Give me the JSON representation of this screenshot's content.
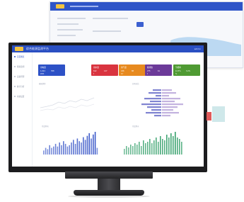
{
  "header": {
    "title": "综合能源监测平台",
    "user": "admin"
  },
  "sidebar": {
    "items": [
      {
        "label": "首页概览",
        "active": true
      },
      {
        "label": "能耗监测",
        "active": false
      },
      {
        "label": "设备管理",
        "active": false
      },
      {
        "label": "统计分析",
        "active": false
      },
      {
        "label": "系统设置",
        "active": false
      }
    ]
  },
  "stat_cards": [
    {
      "title": "用电量",
      "color": "#2d51c6",
      "v1": "1,024",
      "v2": "358",
      "v3": "kWh"
    },
    {
      "title": "用水量",
      "color": "#d9343f",
      "v1": "612",
      "v2": "127",
      "v3": "t"
    },
    {
      "title": "用气量",
      "color": "#e78a1f",
      "v1": "436",
      "v2": "88",
      "v3": "m³"
    },
    {
      "title": "碳排放",
      "color": "#6c3a99",
      "v1": "275",
      "v2": "61",
      "v3": "t"
    },
    {
      "title": "节能率",
      "color": "#4f9a33",
      "v1": "12.5%",
      "v2": "3.2%",
      "v3": "%"
    }
  ],
  "chart_labels": {
    "left_top": "能耗趋势",
    "right_top": "分项对比",
    "left_bottom": "月度用电",
    "right_bottom": "月度用水"
  },
  "colors": {
    "header": "#2a4fc2",
    "bar_blue": "#3c59c9",
    "bar_green": "#35a06b",
    "accent_yellow": "#f3c33f"
  },
  "bottom_bars_left": [
    3,
    5,
    4,
    7,
    5,
    6,
    8,
    6,
    9,
    7,
    10,
    8,
    6,
    7,
    9,
    11,
    8,
    12,
    10,
    9,
    13,
    11,
    14,
    16,
    12,
    15,
    17,
    5
  ],
  "bottom_bars_right": [
    4,
    6,
    5,
    7,
    6,
    8,
    7,
    9,
    6,
    10,
    8,
    9,
    11,
    8,
    10,
    12,
    9,
    13,
    11,
    10,
    14,
    12,
    15,
    13,
    16,
    12,
    11,
    9
  ],
  "butterfly": {
    "left": [
      6,
      9,
      4,
      12,
      8,
      14,
      10,
      7,
      11,
      5
    ],
    "right": [
      7,
      10,
      5,
      13,
      9,
      15,
      11,
      8,
      12,
      6
    ]
  }
}
